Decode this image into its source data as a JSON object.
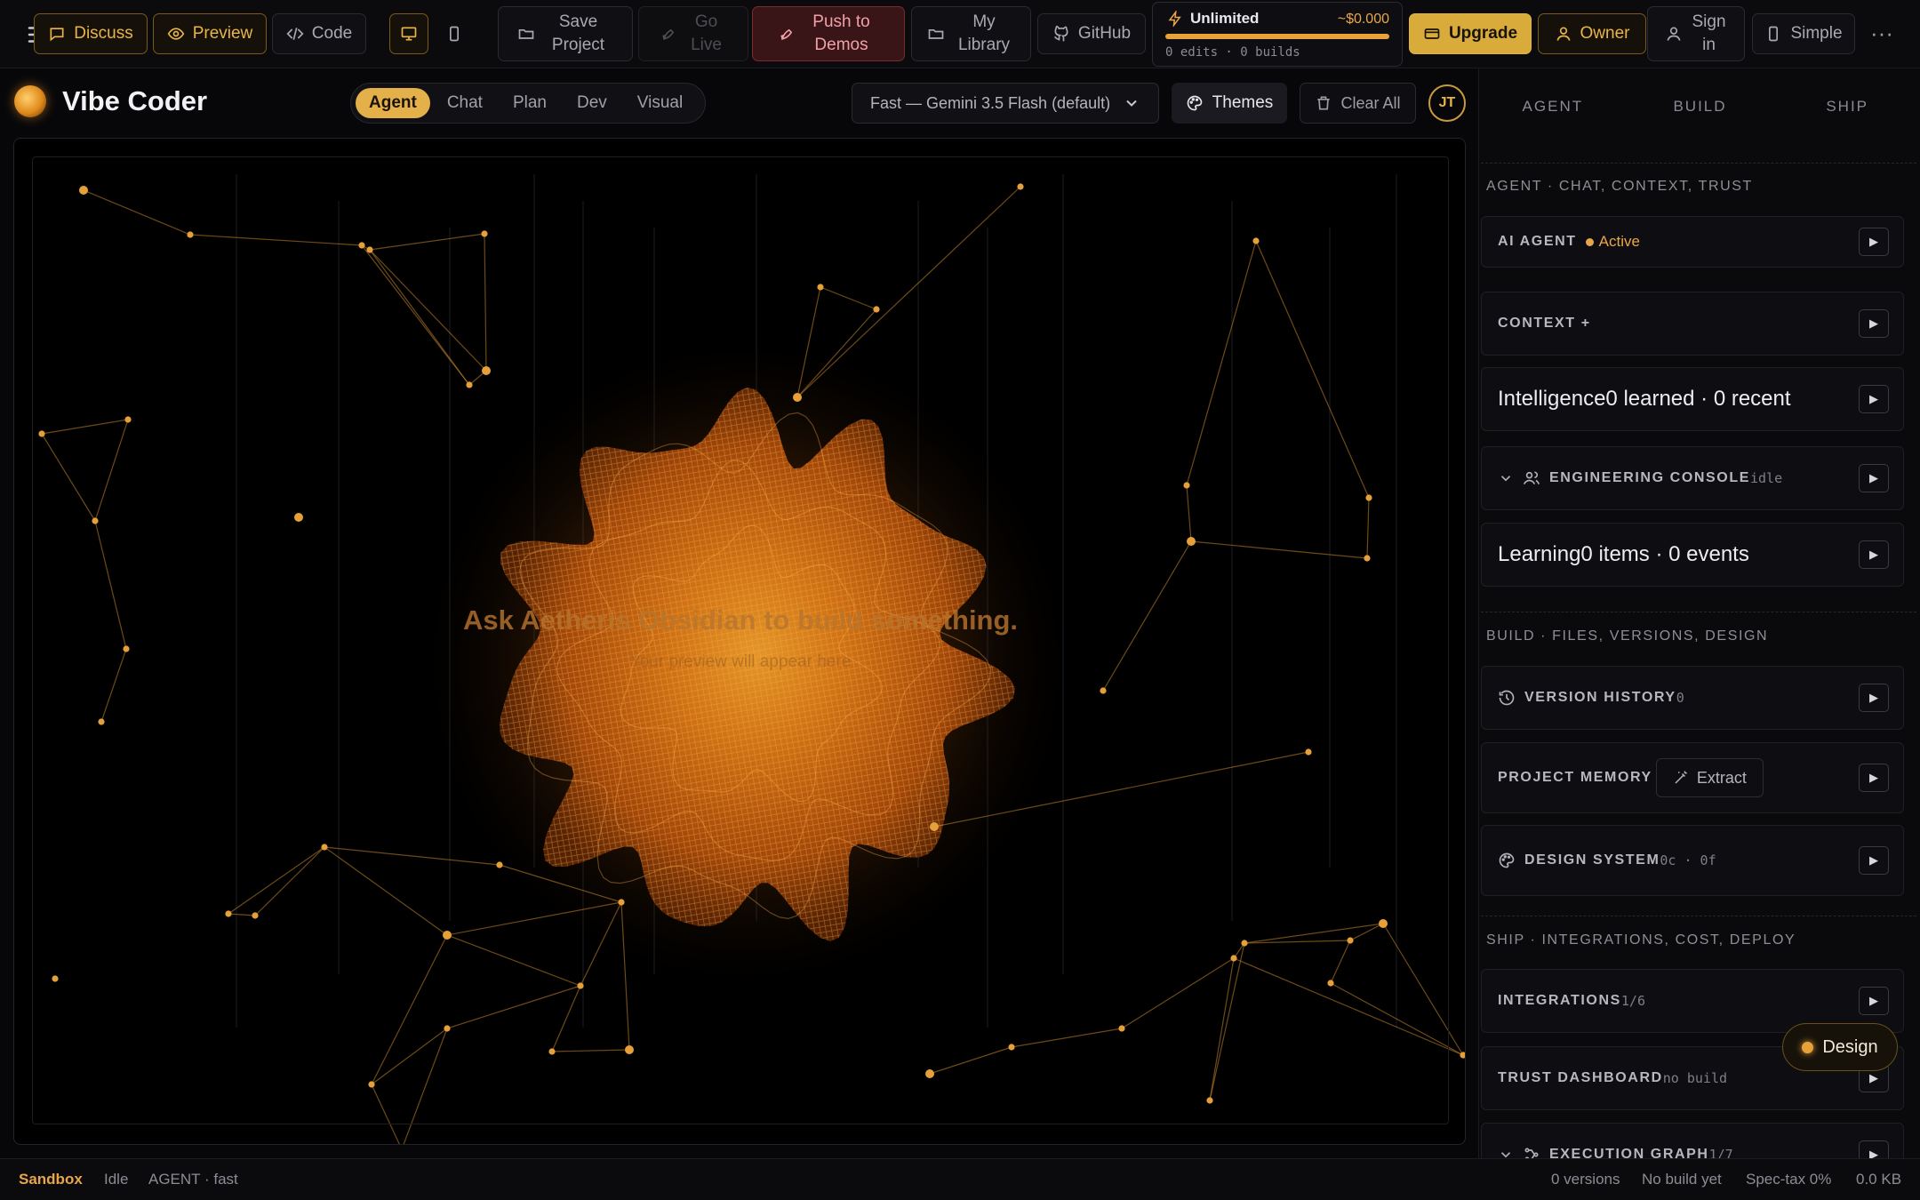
{
  "toolbar": {
    "discuss": "Discuss",
    "preview": "Preview",
    "code": "Code",
    "save_project": "Save Project",
    "go_live": "Go Live",
    "push_to_demos": "Push to Demos",
    "my_library": "My Library",
    "github": "GitHub",
    "upgrade": "Upgrade",
    "owner": "Owner",
    "sign_in": "Sign in",
    "simple": "Simple",
    "more": "···"
  },
  "usage": {
    "title": "Unlimited",
    "cost": "~$0.000",
    "stats": "0 edits · 0 builds",
    "progress": 1.0
  },
  "header": {
    "app_name": "Vibe Coder",
    "modes": [
      "Agent",
      "Chat",
      "Plan",
      "Dev",
      "Visual"
    ],
    "active_mode": "Agent",
    "model": "Fast — Gemini 3.5 Flash (default)",
    "themes": "Themes",
    "clear_all": "Clear All",
    "avatar_initials": "JT"
  },
  "preview": {
    "prompt": "Ask Aetheris Obsidian to build something.",
    "subprompt": "Your preview will appear here"
  },
  "panel": {
    "tabs": [
      "AGENT",
      "BUILD",
      "SHIP"
    ],
    "agent_section": "AGENT · CHAT, CONTEXT, TRUST",
    "build_section": "BUILD · FILES, VERSIONS, DESIGN",
    "ship_section": "SHIP · INTEGRATIONS, COST, DEPLOY",
    "ai_agent": {
      "label": "AI AGENT",
      "status": "Active"
    },
    "context": {
      "label": "CONTEXT +"
    },
    "intelligence": {
      "label": "Intelligence",
      "meta": "0 learned · 0 recent"
    },
    "engineering_console": {
      "label": "ENGINEERING CONSOLE",
      "meta": "idle"
    },
    "learning": {
      "label": "Learning",
      "meta": "0 items · 0 events"
    },
    "version_history": {
      "label": "VERSION HISTORY",
      "meta": "0"
    },
    "project_memory": {
      "label": "PROJECT MEMORY",
      "action": "Extract"
    },
    "design_system": {
      "label": "DESIGN SYSTEM",
      "meta": "0c · 0f"
    },
    "integrations": {
      "label": "INTEGRATIONS",
      "meta": "1/6"
    },
    "trust_dashboard": {
      "label": "TRUST DASHBOARD",
      "meta": "no build"
    },
    "execution_graph": {
      "label": "EXECUTION GRAPH",
      "meta": "1/7"
    },
    "play_glyph": "▶"
  },
  "design_button": "Design",
  "status": {
    "env": "Sandbox",
    "state": "Idle",
    "mode": "AGENT · fast",
    "versions": "0 versions",
    "build": "No build yet",
    "spec_tax": "Spec-tax 0%",
    "size": "0.0 KB"
  },
  "colors": {
    "accent": "#e3b04a",
    "accent_orange": "#e8a64a",
    "danger": "#3a1518"
  }
}
